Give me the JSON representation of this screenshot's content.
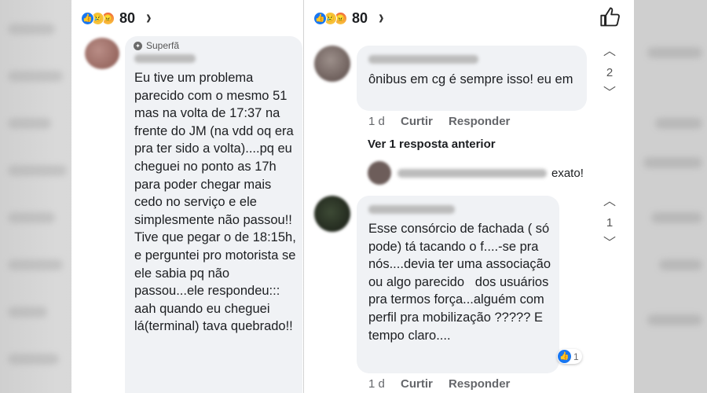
{
  "left_panel": {
    "reactions": {
      "count": "80"
    },
    "comment": {
      "badge": "Superfã",
      "author": "Leal Castras",
      "text": "Eu tive um problema parecido com o mesmo 51 mas na volta de 17:37 na frente do JM (na vdd oq era pra ter sido a volta)....pq eu cheguei no ponto as 17h para poder chegar mais cedo no serviço e ele simplesmente não passou!! Tive que pegar o de 18:15h, e perguntei pro motorista se ele sabia pq não passou...ele respondeu::: aah quando eu cheguei lá(terminal) tava quebrado!!"
    }
  },
  "right_panel": {
    "reactions": {
      "count": "80"
    },
    "comment1": {
      "author": "Wendell Guilherme",
      "text": "ônibus em cg é sempre isso! eu em",
      "time": "1 d",
      "reply_label": "Curtir",
      "respond_label": "Responder",
      "votes": "2"
    },
    "more_replies": "Ver 1 resposta anterior",
    "reply_preview": {
      "author": "Wendell Guilherme",
      "text": "exato!"
    },
    "comment2": {
      "author": "Fabrina Fornaro",
      "text": "Esse consórcio de fachada ( só pode) tá tacando o f....-se pra nós....devia ter uma associação ou algo parecido   dos usuários pra termos força...alguém com perfil pra mobilização ????? E tempo claro....",
      "time": "1 d",
      "reply_label": "Curtir",
      "respond_label": "Responder",
      "votes": "1",
      "like_count": "1"
    }
  },
  "colors": {
    "bubble": "#f0f2f5",
    "like_blue": "#1877f2",
    "meta_gray": "#65676b"
  }
}
